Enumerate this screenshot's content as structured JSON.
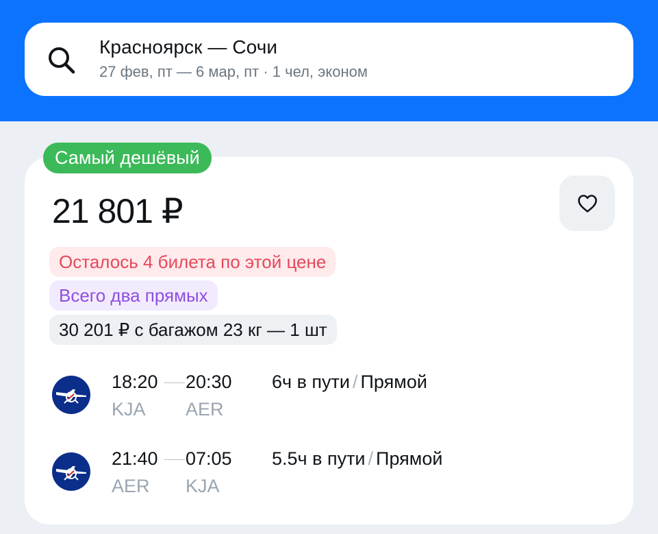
{
  "search": {
    "route": "Красноярск — Сочи",
    "details": "27 фев, пт — 6 мар, пт · 1 чел, эконом"
  },
  "offer": {
    "badge": "Самый дешёвый",
    "price": "21 801 ₽",
    "tags": {
      "seats_left": "Осталось 4 билета по этой цене",
      "direct": "Всего два прямых",
      "baggage": "30 201 ₽ с багажом 23 кг — 1 шт"
    },
    "segments": [
      {
        "dep_time": "18:20",
        "arr_time": "20:30",
        "dep_code": "KJA",
        "arr_code": "AER",
        "duration": "6ч в пути",
        "separator": "/",
        "type": "Прямой"
      },
      {
        "dep_time": "21:40",
        "arr_time": "07:05",
        "dep_code": "AER",
        "arr_code": "KJA",
        "duration": "5.5ч в пути",
        "separator": "/",
        "type": "Прямой"
      }
    ]
  },
  "icons": {
    "search": "search-icon",
    "favorite": "heart-icon",
    "airline": "airline-logo-icon"
  },
  "colors": {
    "header": "#0c73fe",
    "badge": "#3cba5a",
    "alert_text": "#e4495a",
    "purple_text": "#8e4ee0",
    "airline": "#0b2e8a"
  }
}
